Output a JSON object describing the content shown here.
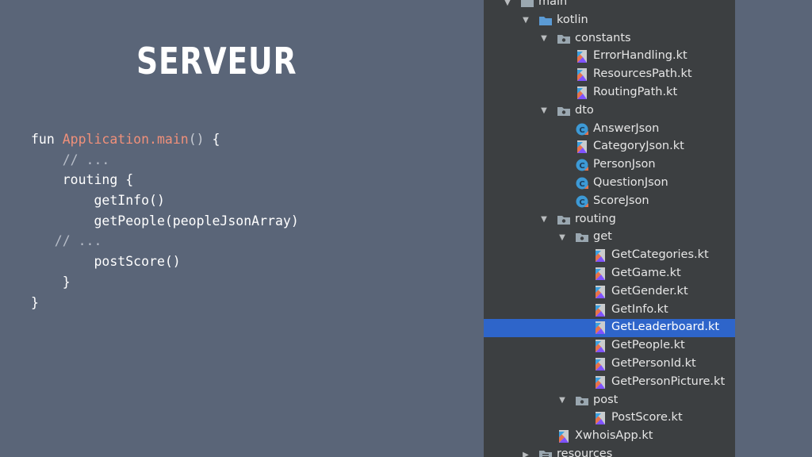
{
  "slide": {
    "title": "Serveur"
  },
  "code": {
    "lines": [
      [
        "fun ",
        "Application.main",
        "()",
        " {"
      ],
      [
        "    // ..."
      ],
      [
        "    routing {"
      ],
      [
        "        getInfo()"
      ],
      [
        "        getPeople(peopleJsonArray)"
      ],
      [
        "   // ..."
      ],
      [
        "        postScore()"
      ],
      [
        "    }"
      ],
      [
        "}"
      ]
    ],
    "colors": {
      "keyword": "#ffffff",
      "function": "#f0907a",
      "comment": "#b7bdc8"
    }
  },
  "tree": {
    "background": "#3c3f41",
    "selected_color": "#2e65ca",
    "items": [
      {
        "label": "main",
        "icon": "folder-icon",
        "arrow": "expanded",
        "depth": 0
      },
      {
        "label": "kotlin",
        "icon": "blue-folder-icon",
        "arrow": "expanded",
        "depth": 1
      },
      {
        "label": "constants",
        "icon": "package-icon",
        "arrow": "expanded",
        "depth": 2
      },
      {
        "label": "ErrorHandling.kt",
        "icon": "kotlin-file-icon",
        "arrow": "none",
        "depth": 3
      },
      {
        "label": "ResourcesPath.kt",
        "icon": "kotlin-file-icon",
        "arrow": "none",
        "depth": 3
      },
      {
        "label": "RoutingPath.kt",
        "icon": "kotlin-file-icon",
        "arrow": "none",
        "depth": 3
      },
      {
        "label": "dto",
        "icon": "package-icon",
        "arrow": "expanded",
        "depth": 2
      },
      {
        "label": "AnswerJson",
        "icon": "kotlin-class-icon",
        "arrow": "none",
        "depth": 3
      },
      {
        "label": "CategoryJson.kt",
        "icon": "kotlin-file-icon",
        "arrow": "none",
        "depth": 3
      },
      {
        "label": "PersonJson",
        "icon": "kotlin-class-icon",
        "arrow": "none",
        "depth": 3
      },
      {
        "label": "QuestionJson",
        "icon": "kotlin-class-icon",
        "arrow": "none",
        "depth": 3
      },
      {
        "label": "ScoreJson",
        "icon": "kotlin-class-icon",
        "arrow": "none",
        "depth": 3
      },
      {
        "label": "routing",
        "icon": "package-icon",
        "arrow": "expanded",
        "depth": 2
      },
      {
        "label": "get",
        "icon": "package-icon",
        "arrow": "expanded",
        "depth": 3
      },
      {
        "label": "GetCategories.kt",
        "icon": "kotlin-file-icon",
        "arrow": "none",
        "depth": 4
      },
      {
        "label": "GetGame.kt",
        "icon": "kotlin-file-icon",
        "arrow": "none",
        "depth": 4
      },
      {
        "label": "GetGender.kt",
        "icon": "kotlin-file-icon",
        "arrow": "none",
        "depth": 4
      },
      {
        "label": "GetInfo.kt",
        "icon": "kotlin-file-icon",
        "arrow": "none",
        "depth": 4
      },
      {
        "label": "GetLeaderboard.kt",
        "icon": "kotlin-file-icon",
        "arrow": "none",
        "depth": 4,
        "selected": true
      },
      {
        "label": "GetPeople.kt",
        "icon": "kotlin-file-icon",
        "arrow": "none",
        "depth": 4
      },
      {
        "label": "GetPersonId.kt",
        "icon": "kotlin-file-icon",
        "arrow": "none",
        "depth": 4
      },
      {
        "label": "GetPersonPicture.kt",
        "icon": "kotlin-file-icon",
        "arrow": "none",
        "depth": 4
      },
      {
        "label": "post",
        "icon": "package-icon",
        "arrow": "expanded",
        "depth": 3
      },
      {
        "label": "PostScore.kt",
        "icon": "kotlin-file-icon",
        "arrow": "none",
        "depth": 4
      },
      {
        "label": "XwhoisApp.kt",
        "icon": "kotlin-file-icon",
        "arrow": "none",
        "depth": 2
      },
      {
        "label": "resources",
        "icon": "resources-folder-icon",
        "arrow": "collapsed",
        "depth": 1
      }
    ]
  }
}
